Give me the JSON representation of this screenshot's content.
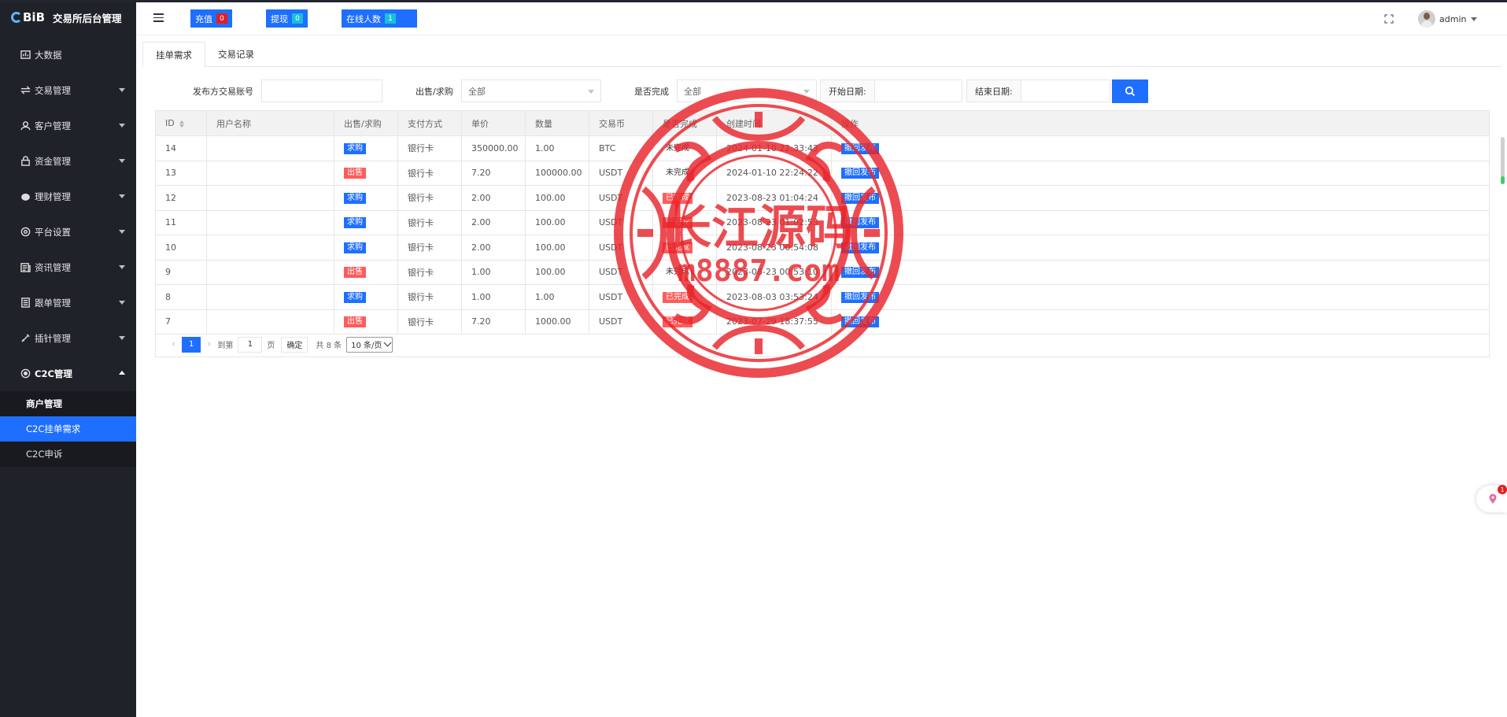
{
  "app": {
    "logo_text": "BiB",
    "title": "交易所后台管理"
  },
  "sidebar": {
    "items": [
      {
        "label": "大数据",
        "icon": "chart-icon"
      },
      {
        "label": "交易管理",
        "icon": "exchange-icon"
      },
      {
        "label": "客户管理",
        "icon": "users-icon"
      },
      {
        "label": "资金管理",
        "icon": "lock-icon"
      },
      {
        "label": "理财管理",
        "icon": "piggy-bank-icon"
      },
      {
        "label": "平台设置",
        "icon": "gear-icon"
      },
      {
        "label": "资讯管理",
        "icon": "news-icon"
      },
      {
        "label": "跟单管理",
        "icon": "document-icon"
      },
      {
        "label": "插针管理",
        "icon": "needle-icon"
      },
      {
        "label": "C2C管理",
        "icon": "circle-gear-icon"
      }
    ],
    "submenu": [
      "商户管理",
      "C2C挂单需求",
      "C2C申诉"
    ],
    "active_sub": "C2C挂单需求"
  },
  "header": {
    "recharge": {
      "label": "充值",
      "count": "0"
    },
    "withdraw": {
      "label": "提现",
      "count": "0"
    },
    "online": {
      "label": "在线人数",
      "count": "1"
    },
    "username": "admin"
  },
  "tabs": [
    "挂单需求",
    "交易记录"
  ],
  "filters": {
    "account_label": "发布方交易账号",
    "account_value": "",
    "side_label": "出售/求购",
    "side_value": "全部",
    "done_label": "是否完成",
    "done_value": "全部",
    "start_label": "开始日期:",
    "end_label": "结束日期:"
  },
  "table": {
    "columns": [
      "ID",
      "用户名称",
      "出售/求购",
      "支付方式",
      "单价",
      "数量",
      "交易币",
      "是否完成",
      "创建时间",
      "操作"
    ],
    "rows": [
      {
        "id": "14",
        "user": "",
        "side": "求购",
        "side_type": "buy",
        "pay": "银行卡",
        "price": "350000.00",
        "qty": "1.00",
        "coin": "BTC",
        "status": "未完成",
        "status_type": "pending",
        "time": "2024-01-10 22:33:43",
        "action": "撤回发布"
      },
      {
        "id": "13",
        "user": "",
        "side": "出售",
        "side_type": "sell",
        "pay": "银行卡",
        "price": "7.20",
        "qty": "100000.00",
        "coin": "USDT",
        "status": "未完成",
        "status_type": "pending",
        "time": "2024-01-10 22:24:22",
        "action": "撤回发布"
      },
      {
        "id": "12",
        "user": "",
        "side": "求购",
        "side_type": "buy",
        "pay": "银行卡",
        "price": "2.00",
        "qty": "100.00",
        "coin": "USDT",
        "status": "已完成",
        "status_type": "done",
        "time": "2023-08-23 01:04:24",
        "action": "撤回发布"
      },
      {
        "id": "11",
        "user": "",
        "side": "求购",
        "side_type": "buy",
        "pay": "银行卡",
        "price": "2.00",
        "qty": "100.00",
        "coin": "USDT",
        "status": "已完成",
        "status_type": "done",
        "time": "2023-08-23 01:02:53",
        "action": "撤回发布"
      },
      {
        "id": "10",
        "user": "",
        "side": "求购",
        "side_type": "buy",
        "pay": "银行卡",
        "price": "2.00",
        "qty": "100.00",
        "coin": "USDT",
        "status": "已完成",
        "status_type": "done",
        "time": "2023-08-23 00:54:08",
        "action": "撤回发布"
      },
      {
        "id": "9",
        "user": "",
        "side": "出售",
        "side_type": "sell",
        "pay": "银行卡",
        "price": "1.00",
        "qty": "100.00",
        "coin": "USDT",
        "status": "未完成",
        "status_type": "pending",
        "time": "2023-08-23 00:53:10",
        "action": "撤回发布"
      },
      {
        "id": "8",
        "user": "",
        "side": "求购",
        "side_type": "buy",
        "pay": "银行卡",
        "price": "1.00",
        "qty": "1.00",
        "coin": "USDT",
        "status": "已完成",
        "status_type": "done",
        "time": "2023-08-03 03:53:24",
        "action": "撤回发布"
      },
      {
        "id": "7",
        "user": "",
        "side": "出售",
        "side_type": "sell",
        "pay": "银行卡",
        "price": "7.20",
        "qty": "1000.00",
        "coin": "USDT",
        "status": "已完成",
        "status_type": "done",
        "time": "2023-07-29 18:37:55",
        "action": "撤回发布"
      }
    ]
  },
  "pager": {
    "current": "1",
    "goto_label": "到第",
    "goto_value": "1",
    "page_unit": "页",
    "confirm": "确定",
    "total": "共 8 条",
    "page_size": "10 条/页"
  },
  "float_widget": {
    "badge": "1"
  },
  "watermark": {
    "line1": "长江源码",
    "line2": "m8887.com"
  },
  "colors": {
    "primary": "#1e6fff",
    "danger": "#ff5b5b",
    "sidebar": "#20222a"
  }
}
